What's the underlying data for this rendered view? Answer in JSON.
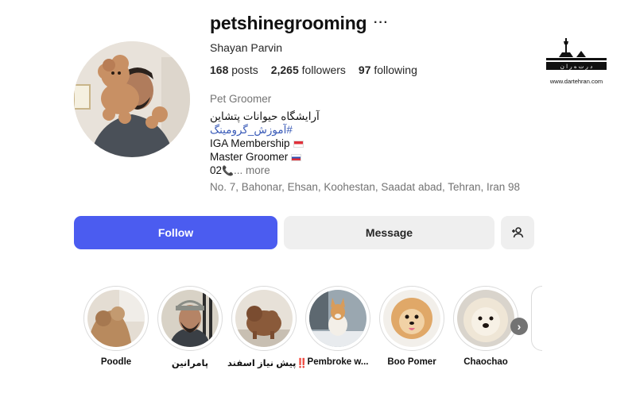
{
  "profile": {
    "username": "petshinegrooming",
    "more_icon": "more-horizontal-icon",
    "full_name": "Shayan Parvin",
    "stats": [
      {
        "count": "168",
        "label": "posts"
      },
      {
        "count": "2,265",
        "label": "followers"
      },
      {
        "count": "97",
        "label": "following"
      }
    ],
    "category": "Pet Groomer",
    "bio": {
      "line1": "آرایشگاه حیوانات پتشاین",
      "hashtag": "#آموزش_گرومینگ",
      "line3": "IGA Membership",
      "line4": "Master Groomer",
      "line5": "02",
      "more": "... more"
    },
    "address": "No. 7, Bahonar, Ehsan, Koohestan, Saadat abad, Tehran, Iran 98"
  },
  "actions": {
    "follow_label": "Follow",
    "message_label": "Message",
    "add_user_icon": "person-add-icon"
  },
  "highlights": [
    {
      "label": "Poodle"
    },
    {
      "label": "پامرانین"
    },
    {
      "label": "پیش نیاز اسفند",
      "suffix": "‼️"
    },
    {
      "label": "Pembroke w..."
    },
    {
      "label": "Boo Pomer"
    },
    {
      "label": "Chaochao"
    }
  ],
  "watermark": {
    "url": "www.dartehran.com"
  },
  "colors": {
    "follow_bg": "#4b5cf0",
    "secondary_btn_bg": "#efefef",
    "hashtag": "#3a5bb8",
    "muted_text": "#737373"
  }
}
